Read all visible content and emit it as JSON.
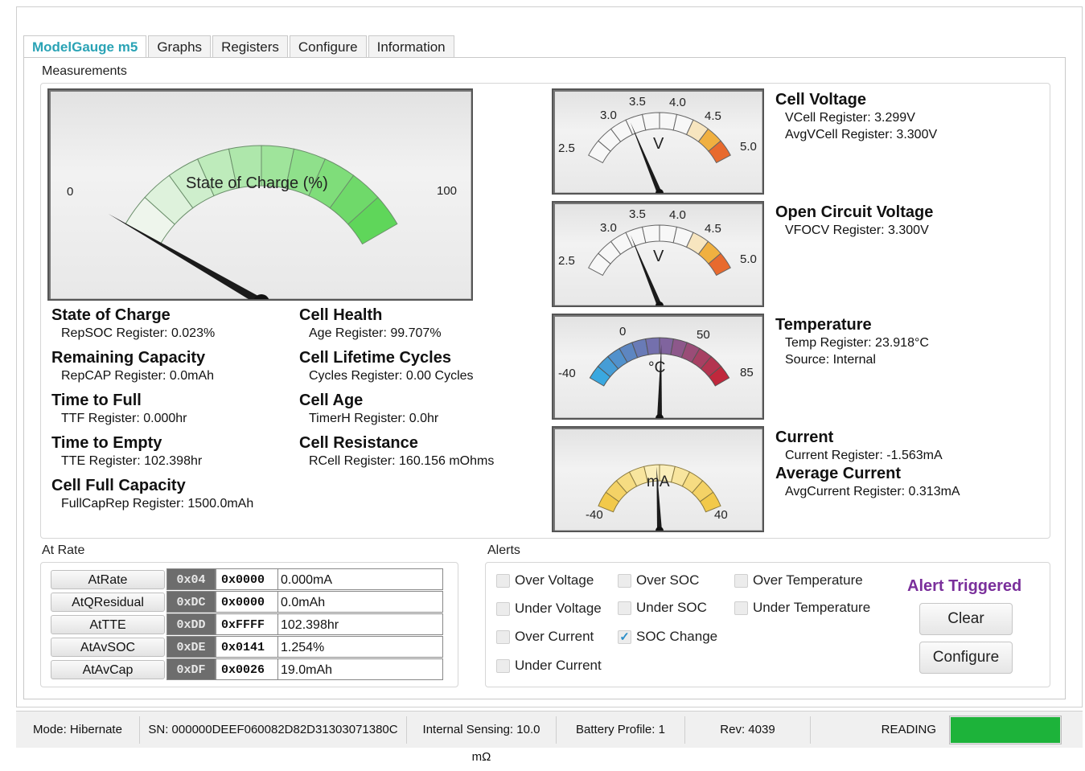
{
  "tabs": [
    "ModelGauge m5",
    "Graphs",
    "Registers",
    "Configure",
    "Information"
  ],
  "measurements_label": "Measurements",
  "soc_gauge": {
    "title": "State of Charge (%)",
    "min_label": "0",
    "max_label": "100",
    "value_percent": 0.023
  },
  "voltage_ticks": [
    "2.5",
    "3.0",
    "3.5",
    "4.0",
    "4.5",
    "5.0"
  ],
  "voltage_unit": "V",
  "temp_gauge": {
    "unit": "°C",
    "ticks": [
      "-40",
      "0",
      "50",
      "85"
    ],
    "value": 23.918
  },
  "current_gauge": {
    "unit": "mA",
    "ticks": [
      "-40",
      "40"
    ],
    "value": -1.563
  },
  "left_info": [
    {
      "title": "State of Charge",
      "sub": "RepSOC Register: 0.023%"
    },
    {
      "title": "Remaining Capacity",
      "sub": "RepCAP Register: 0.0mAh"
    },
    {
      "title": "Time to Full",
      "sub": "TTF Register: 0.000hr"
    },
    {
      "title": "Time to Empty",
      "sub": "TTE Register: 102.398hr"
    },
    {
      "title": "Cell Full Capacity",
      "sub": "FullCapRep Register: 1500.0mAh"
    }
  ],
  "mid_info": [
    {
      "title": "Cell Health",
      "sub": "Age Register: 99.707%"
    },
    {
      "title": "Cell Lifetime Cycles",
      "sub": "Cycles Register: 0.00 Cycles"
    },
    {
      "title": "Cell Age",
      "sub": "TimerH Register: 0.0hr"
    },
    {
      "title": "Cell Resistance",
      "sub": "RCell Register: 160.156 mOhms"
    }
  ],
  "cell_voltage": {
    "title": "Cell Voltage",
    "line1": "VCell Register: 3.299V",
    "line2": "AvgVCell Register: 3.300V",
    "value": 3.299
  },
  "ocv": {
    "title": "Open Circuit Voltage",
    "line1": "VFOCV Register: 3.300V",
    "value": 3.3
  },
  "temperature": {
    "title": "Temperature",
    "line1": "Temp Register: 23.918°C",
    "line2": "Source: Internal"
  },
  "current": {
    "title": "Current",
    "line1": "Current Register: -1.563mA",
    "title2": "Average Current",
    "line2": "AvgCurrent Register: 0.313mA"
  },
  "at_rate_label": "At Rate",
  "at_rate_rows": [
    {
      "button": "AtRate",
      "addr": "0x04",
      "hex": "0x0000",
      "value": "0.000mA"
    },
    {
      "button": "AtQResidual",
      "addr": "0xDC",
      "hex": "0x0000",
      "value": "0.0mAh"
    },
    {
      "button": "AtTTE",
      "addr": "0xDD",
      "hex": "0xFFFF",
      "value": "102.398hr"
    },
    {
      "button": "AtAvSOC",
      "addr": "0xDE",
      "hex": "0x0141",
      "value": "1.254%"
    },
    {
      "button": "AtAvCap",
      "addr": "0xDF",
      "hex": "0x0026",
      "value": "19.0mAh"
    }
  ],
  "alerts_label": "Alerts",
  "alerts": {
    "over_voltage": {
      "label": "Over Voltage",
      "checked": false
    },
    "over_soc": {
      "label": "Over SOC",
      "checked": false
    },
    "over_temperature": {
      "label": "Over Temperature",
      "checked": false
    },
    "under_voltage": {
      "label": "Under Voltage",
      "checked": false
    },
    "under_soc": {
      "label": "Under SOC",
      "checked": false
    },
    "under_temperature": {
      "label": "Under Temperature",
      "checked": false
    },
    "over_current": {
      "label": "Over Current",
      "checked": false
    },
    "soc_change": {
      "label": "SOC Change",
      "checked": true
    },
    "under_current": {
      "label": "Under Current",
      "checked": false
    }
  },
  "alert_triggered": "Alert Triggered",
  "alert_color": "#7a2f9b",
  "buttons": {
    "clear": "Clear",
    "configure": "Configure"
  },
  "status": {
    "mode": "Mode: Hibernate",
    "sn": "SN: 000000DEEF060082D82D31303071380C",
    "sensing": "Internal Sensing: 10.0 mΩ",
    "profile": "Battery Profile: 1",
    "rev": "Rev: 4039",
    "reading": "READING",
    "reading_progress": 1.0,
    "reading_color": "#1db33a"
  }
}
